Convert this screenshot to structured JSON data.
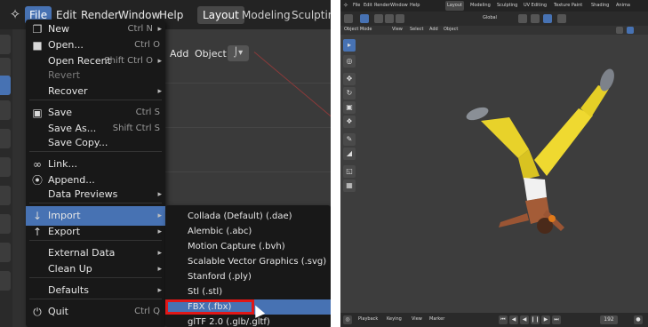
{
  "left": {
    "menubar": {
      "items": [
        {
          "label": "File",
          "active": true
        },
        {
          "label": "Edit"
        },
        {
          "label": "Render"
        },
        {
          "label": "Window"
        },
        {
          "label": "Help"
        }
      ],
      "workspaces": [
        {
          "label": "Layout",
          "active": true
        },
        {
          "label": "Modeling"
        },
        {
          "label": "Sculpting"
        }
      ]
    },
    "viewport_header": {
      "add": "Add",
      "object": "Object"
    },
    "file_menu": [
      {
        "label": "New",
        "shortcut": "Ctrl N",
        "icon": "new-file-icon",
        "submenu": true
      },
      {
        "label": "Open...",
        "shortcut": "Ctrl O",
        "icon": "folder-icon"
      },
      {
        "label": "Open Recent",
        "shortcut": "Shift Ctrl O",
        "submenu": true
      },
      {
        "label": "Revert",
        "disabled": true
      },
      {
        "label": "Recover",
        "submenu": true
      },
      {
        "label": "Save",
        "shortcut": "Ctrl S",
        "icon": "save-icon"
      },
      {
        "label": "Save As...",
        "shortcut": "Shift Ctrl S"
      },
      {
        "label": "Save Copy..."
      },
      {
        "label": "Link...",
        "icon": "link-icon"
      },
      {
        "label": "Append...",
        "icon": "append-icon"
      },
      {
        "label": "Data Previews",
        "submenu": true
      },
      {
        "label": "Import",
        "icon": "import-icon",
        "submenu": true,
        "highlighted": true
      },
      {
        "label": "Export",
        "icon": "export-icon",
        "submenu": true
      },
      {
        "label": "External Data",
        "submenu": true
      },
      {
        "label": "Clean Up",
        "submenu": true
      },
      {
        "label": "Defaults",
        "submenu": true
      },
      {
        "label": "Quit",
        "shortcut": "Ctrl Q",
        "icon": "power-icon"
      }
    ],
    "import_menu": [
      {
        "label": "Collada (Default) (.dae)"
      },
      {
        "label": "Alembic (.abc)"
      },
      {
        "label": "Motion Capture (.bvh)"
      },
      {
        "label": "Scalable Vector Graphics (.svg)"
      },
      {
        "label": "Stanford (.ply)"
      },
      {
        "label": "Stl (.stl)"
      },
      {
        "label": "FBX (.fbx)",
        "highlighted": true
      },
      {
        "label": "glTF 2.0 (.glb/.gltf)"
      }
    ],
    "highlight_color": "#4772b3",
    "annotation_color": "#e01818"
  },
  "right": {
    "menubar": {
      "items": [
        "File",
        "Edit",
        "Render",
        "Window",
        "Help"
      ],
      "workspaces": [
        {
          "label": "Layout",
          "active": true
        },
        {
          "label": "Modeling"
        },
        {
          "label": "Sculpting"
        },
        {
          "label": "UV Editing"
        },
        {
          "label": "Texture Paint"
        },
        {
          "label": "Shading"
        },
        {
          "label": "Anima"
        }
      ]
    },
    "toolbar": {
      "orientation": "Global"
    },
    "header": {
      "mode": "Object Mode",
      "view": "View",
      "select": "Select",
      "add": "Add",
      "object": "Object"
    },
    "timeline": {
      "playback": "Playback",
      "keying": "Keying",
      "view": "View",
      "marker": "Marker",
      "frame": "192"
    }
  }
}
